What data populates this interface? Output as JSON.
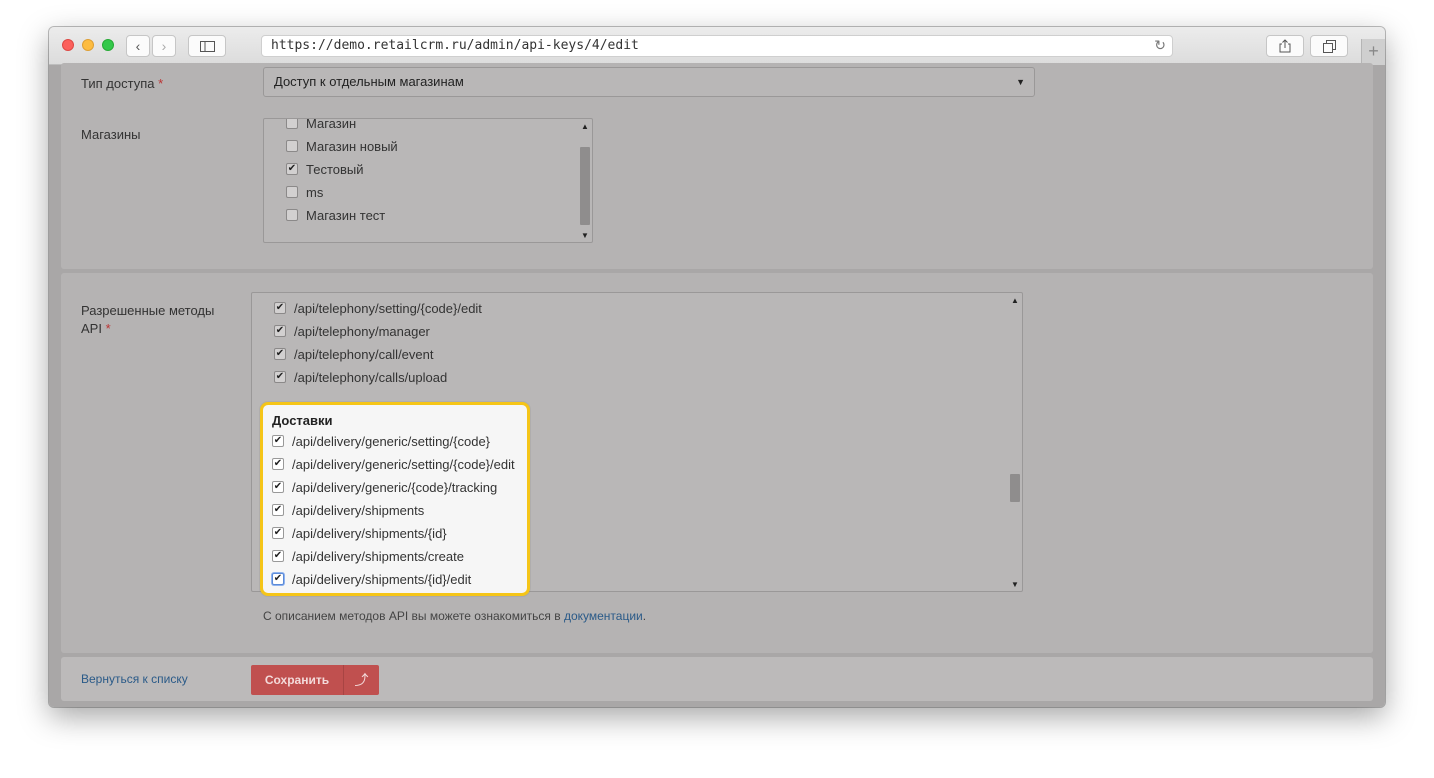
{
  "browser": {
    "url": "https://demo.retailcrm.ru/admin/api-keys/4/edit",
    "new_tab_symbol": "+"
  },
  "form": {
    "access_type": {
      "label": "Тип доступа",
      "required_mark": "*",
      "value": "Доступ к отдельным магазинам"
    },
    "shops": {
      "label": "Магазины",
      "items": [
        {
          "label": "Магазин",
          "checked": false
        },
        {
          "label": "Магазин новый",
          "checked": false
        },
        {
          "label": "Тестовый",
          "checked": true
        },
        {
          "label": "ms",
          "checked": false
        },
        {
          "label": "Магазин тест",
          "checked": false
        }
      ]
    },
    "api_methods": {
      "label_line1": "Разрешенные методы",
      "label_line2": "API",
      "required_mark": "*",
      "items": [
        {
          "label": "/api/telephony/setting/{code}/edit",
          "checked": true
        },
        {
          "label": "/api/telephony/manager",
          "checked": true
        },
        {
          "label": "/api/telephony/call/event",
          "checked": true
        },
        {
          "label": "/api/telephony/calls/upload",
          "checked": true
        }
      ],
      "delivery_group": {
        "title": "Доставки",
        "items": [
          {
            "label": "/api/delivery/generic/setting/{code}",
            "checked": true
          },
          {
            "label": "/api/delivery/generic/setting/{code}/edit",
            "checked": true
          },
          {
            "label": "/api/delivery/generic/{code}/tracking",
            "checked": true
          },
          {
            "label": "/api/delivery/shipments",
            "checked": true
          },
          {
            "label": "/api/delivery/shipments/{id}",
            "checked": true
          },
          {
            "label": "/api/delivery/shipments/create",
            "checked": true
          },
          {
            "label": "/api/delivery/shipments/{id}/edit",
            "checked": true
          }
        ]
      },
      "hint_text": "С описанием методов API вы можете ознакомиться в ",
      "hint_link": "документации",
      "hint_end": "."
    }
  },
  "footer": {
    "back_link": "Вернуться к списку",
    "save_button": "Сохранить",
    "save_up_symbol": "⤴"
  }
}
